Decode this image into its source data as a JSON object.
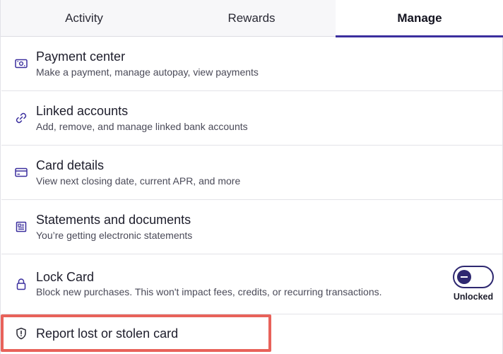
{
  "tabs": [
    {
      "label": "Activity",
      "active": false
    },
    {
      "label": "Rewards",
      "active": false
    },
    {
      "label": "Manage",
      "active": true
    }
  ],
  "accent_color": "#3b2f9e",
  "highlight_color": "#e8625a",
  "menu": [
    {
      "icon": "payment-icon",
      "title": "Payment center",
      "subtitle": "Make a payment, manage autopay, view payments"
    },
    {
      "icon": "link-icon",
      "title": "Linked accounts",
      "subtitle": "Add, remove, and manage linked bank accounts"
    },
    {
      "icon": "credit-card-icon",
      "title": "Card details",
      "subtitle": "View next closing date, current APR, and more"
    },
    {
      "icon": "document-icon",
      "title": "Statements and documents",
      "subtitle": "You’re getting electronic statements"
    },
    {
      "icon": "lock-icon",
      "title": "Lock Card",
      "subtitle": "Block new purchases. This won't impact fees, credits, or recurring transactions."
    },
    {
      "icon": "shield-icon",
      "title": "Report lost or stolen card"
    }
  ],
  "lock_toggle": {
    "state": "Unlocked",
    "on": false
  }
}
